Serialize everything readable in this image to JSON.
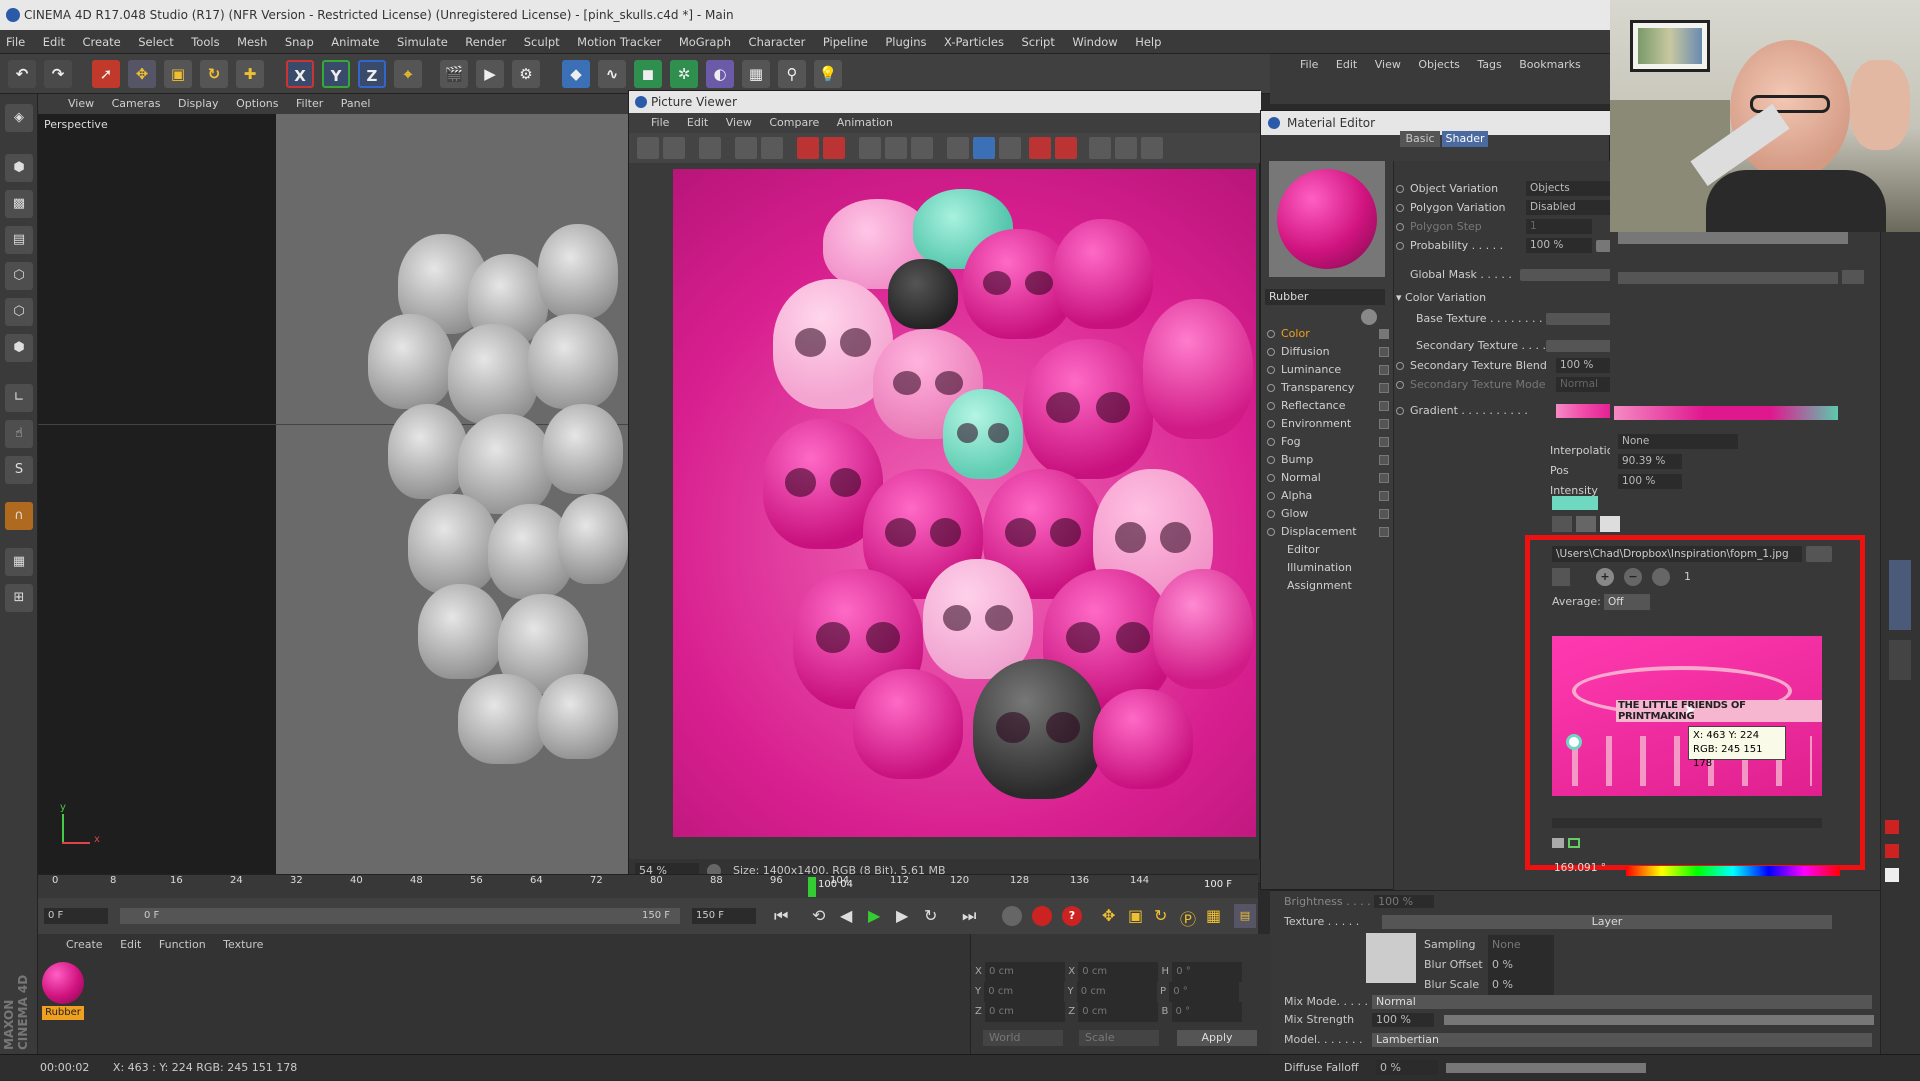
{
  "window": {
    "title": "CINEMA 4D R17.048 Studio (R17) (NFR Version - Restricted License) (Unregistered License) - [pink_skulls.c4d *] - Main"
  },
  "menubar": [
    "File",
    "Edit",
    "Create",
    "Select",
    "Tools",
    "Mesh",
    "Snap",
    "Animate",
    "Simulate",
    "Render",
    "Sculpt",
    "Motion Tracker",
    "MoGraph",
    "Character",
    "Pipeline",
    "Plugins",
    "X-Particles",
    "Script",
    "Window",
    "Help"
  ],
  "toolbar": {
    "x_label": "X",
    "y_label": "Y",
    "z_label": "Z"
  },
  "viewport": {
    "menu": [
      "View",
      "Cameras",
      "Display",
      "Options",
      "Filter",
      "Panel"
    ],
    "label": "Perspective",
    "axis_y": "y",
    "axis_x": "x"
  },
  "picture_viewer": {
    "title": "Picture Viewer",
    "menu": [
      "File",
      "Edit",
      "View",
      "Compare",
      "Animation"
    ],
    "zoom": "54 %",
    "status": "Size: 1400x1400, RGB (8 Bit), 5.61 MB"
  },
  "object_manager": {
    "menu": [
      "File",
      "Edit",
      "View",
      "Objects",
      "Tags",
      "Bookmarks"
    ]
  },
  "material_editor": {
    "title": "Material Editor",
    "material_name": "Rubber",
    "tabs": [
      "Basic",
      "Shader"
    ],
    "channels": [
      "Color",
      "Diffusion",
      "Luminance",
      "Transparency",
      "Reflectance",
      "Environment",
      "Fog",
      "Bump",
      "Normal",
      "Alpha",
      "Glow",
      "Displacement",
      "Editor",
      "Illumination",
      "Assignment"
    ],
    "rows": {
      "object_variation": {
        "label": "Object Variation",
        "value": "Objects"
      },
      "polygon_variation": {
        "label": "Polygon Variation",
        "value": "Disabled"
      },
      "polygon_step": {
        "label": "Polygon Step",
        "value": "1"
      },
      "probability": {
        "label": "Probability . . . . .",
        "value": "100 %"
      },
      "global_mask": {
        "label": "Global Mask . . . . ."
      },
      "color_variation": {
        "label": "Color Variation"
      },
      "base_texture": {
        "label": "Base Texture . . . . . . . ."
      },
      "secondary_texture": {
        "label": "Secondary Texture . . . . ."
      },
      "secondary_blend": {
        "label": "Secondary Texture Blend",
        "value": "100 %"
      },
      "secondary_mode": {
        "label": "Secondary Texture Mode",
        "value": "Normal"
      },
      "gradient": {
        "label": "Gradient . . . . . . . . . ."
      },
      "interpolation": {
        "label": "Interpolation",
        "value": "None"
      },
      "pos": {
        "label": "Pos",
        "value": "90.39 %"
      },
      "intensity": {
        "label": "Intensity",
        "value": "100 %"
      }
    },
    "texture_path": "\\Users\\Chad\\Dropbox\\Inspiration\\fopm_1.jpg",
    "average_label": "Average:",
    "average_value": "Off",
    "layer_count": "1",
    "texture_caption": "THE LITTLE FRIENDS OF PRINTMAKING",
    "tooltip": {
      "xy": "X: 463  Y: 224",
      "rgb": "RGB: 245 151 178"
    },
    "h_value": "169.091 °"
  },
  "timeline": {
    "ticks": [
      "0",
      "8",
      "16",
      "24",
      "32",
      "40",
      "48",
      "56",
      "64",
      "72",
      "80",
      "88",
      "96",
      "104",
      "112",
      "120",
      "128",
      "136",
      "144"
    ],
    "current": "100 04",
    "end": "100 F",
    "start_field": "0 F",
    "start_field2": "0 F",
    "end_field": "150 F",
    "end_field2": "150 F"
  },
  "material_manager": {
    "menu": [
      "Create",
      "Edit",
      "Function",
      "Texture"
    ],
    "material_label": "Rubber"
  },
  "coordinates": {
    "rows": [
      [
        "X",
        "0 cm",
        "X",
        "0 cm",
        "H",
        "0 °"
      ],
      [
        "Y",
        "0 cm",
        "Y",
        "0 cm",
        "P",
        "0 °"
      ],
      [
        "Z",
        "0 cm",
        "Z",
        "0 cm",
        "B",
        "0 °"
      ]
    ],
    "world": "World",
    "scale": "Scale",
    "apply": "Apply"
  },
  "lower_attributes": {
    "brightness": {
      "label": "Brightness . . . .",
      "value": "100 %"
    },
    "texture": {
      "label": "Texture . . . . .",
      "value": "Layer"
    },
    "sampling": {
      "label": "Sampling",
      "value": "None"
    },
    "blur_offset": {
      "label": "Blur Offset",
      "value": "0 %"
    },
    "blur_scale": {
      "label": "Blur Scale",
      "value": "0 %"
    },
    "mix_mode": {
      "label": "Mix Mode. . . . .",
      "value": "Normal"
    },
    "mix_strength": {
      "label": "Mix Strength",
      "value": "100 %"
    },
    "model": {
      "label": "Model. . . . . . .",
      "value": "Lambertian"
    },
    "diffuse_falloff": {
      "label": "Diffuse Falloff",
      "value": "0 %"
    }
  },
  "statusbar": {
    "time": "00:00:02",
    "info": "X: 463 : Y: 224  RGB: 245 151 178"
  },
  "brand": "MAXON CINEMA 4D",
  "colors": {
    "accent_orange": "#f0a020",
    "pink": "#d81f8f",
    "red_highlight": "#ee1111",
    "teal": "#6fd8c0"
  }
}
